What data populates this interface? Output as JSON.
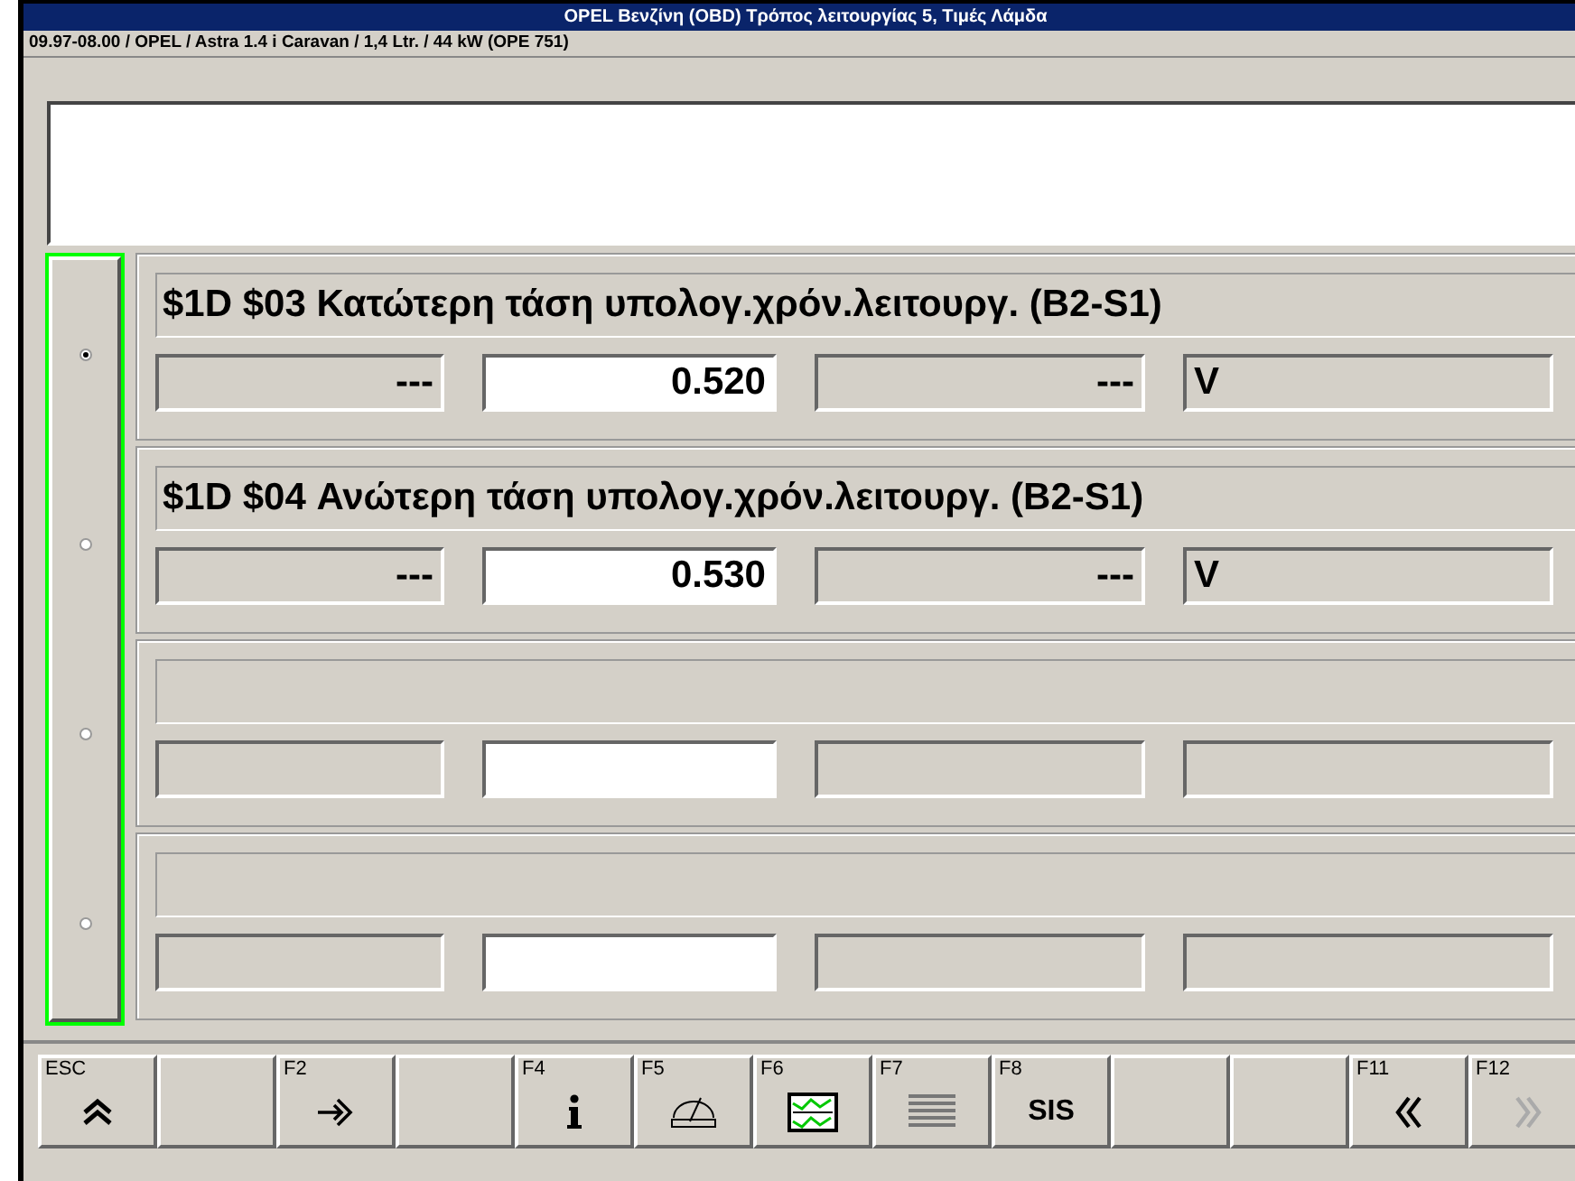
{
  "window": {
    "title": "OPEL  Βενζίνη  (OBD)  Τρόπος λειτουργίας 5,    Τιμές Λάμδα"
  },
  "vehicle": "09.97-08.00 / OPEL / Astra 1.4 i Caravan / 1,4 Ltr. / 44 kW  (OPE 751)",
  "rows": [
    {
      "selected": true,
      "title": "$1D $03 Κατώτερη τάση υπολογ.χρόν.λειτουργ. (B2-S1)",
      "min": "---",
      "value": "0.520",
      "max": "---",
      "unit": "V"
    },
    {
      "selected": false,
      "title": "$1D $04 Ανώτερη τάση υπολογ.χρόν.λειτουργ. (B2-S1)",
      "min": "---",
      "value": "0.530",
      "max": "---",
      "unit": "V"
    },
    {
      "selected": false
    },
    {
      "selected": false
    }
  ],
  "function_keys": [
    {
      "key": "ESC",
      "kind": "up",
      "disabled": false
    },
    {
      "kind": "blank"
    },
    {
      "key": "F2",
      "kind": "enter",
      "disabled": false
    },
    {
      "kind": "blank"
    },
    {
      "key": "F4",
      "kind": "info",
      "disabled": false
    },
    {
      "key": "F5",
      "kind": "gauge",
      "disabled": false
    },
    {
      "key": "F6",
      "kind": "graph",
      "disabled": false
    },
    {
      "key": "F7",
      "kind": "list",
      "disabled": false
    },
    {
      "key": "F8",
      "kind": "text",
      "text": "SIS",
      "disabled": false
    },
    {
      "kind": "blank"
    },
    {
      "kind": "blank"
    },
    {
      "key": "F11",
      "kind": "back",
      "disabled": false
    },
    {
      "key": "F12",
      "kind": "forward",
      "disabled": true
    }
  ]
}
